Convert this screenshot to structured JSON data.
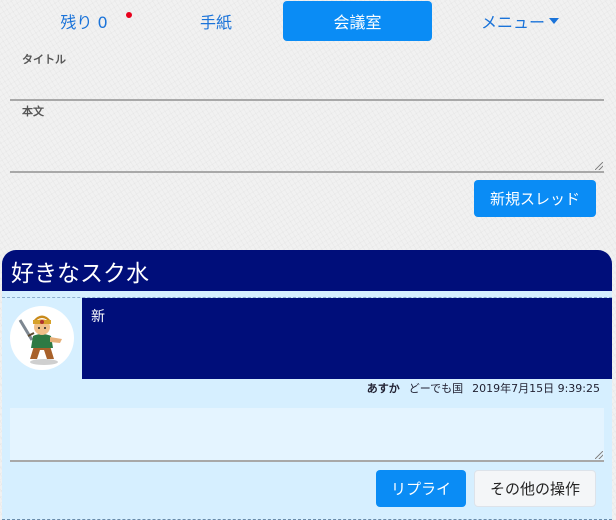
{
  "nav": {
    "remaining_label": "残り 0",
    "letters_label": "手紙",
    "conference_label": "会議室",
    "menu_label": "メニュー"
  },
  "colors": {
    "accent": "#0a8cf5",
    "thread_header_bg": "#000e7a",
    "thread_bg": "#d6efff",
    "notify_dot": "#e8001c"
  },
  "form": {
    "title_label": "タイトル",
    "body_label": "本文",
    "new_thread_button": "新規スレッド"
  },
  "thread": {
    "title": "好きなスク水",
    "post": {
      "body": "新",
      "author": "あすか",
      "country": "どーでも国",
      "timestamp": "2019年7月15日 9:39:25"
    },
    "reply_button": "リプライ",
    "other_actions_button": "その他の操作"
  }
}
